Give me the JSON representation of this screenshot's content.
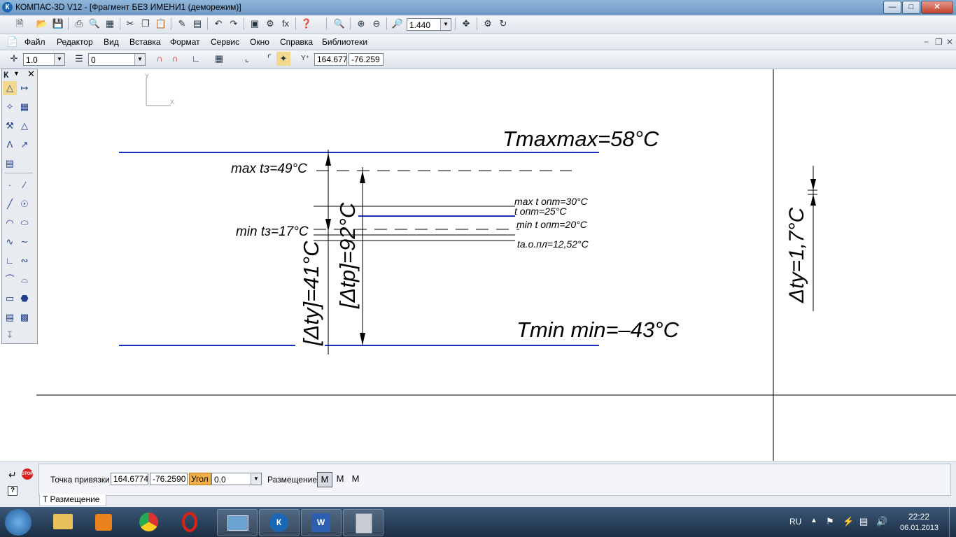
{
  "window": {
    "title": "КОМПАС-3D V12 - [Фрагмент БЕЗ ИМЕНИ1 (деморежим)]",
    "app_icon": "kompas-logo-icon",
    "controls": [
      "minimize-icon",
      "maximize-icon",
      "close-icon"
    ]
  },
  "standard_toolbar": {
    "zoom_value": "1.440"
  },
  "menu": {
    "items": [
      "Файл",
      "Редактор",
      "Вид",
      "Вставка",
      "Формат",
      "Сервис",
      "Окно",
      "Справка",
      "Библиотеки"
    ]
  },
  "current_state_bar": {
    "step_value": "1.0",
    "layer_value": "0",
    "coord_x": "164.677",
    "coord_y": "-76.259"
  },
  "palette": {
    "header": "К"
  },
  "drawing": {
    "axis_y": "Y",
    "axis_x": "X",
    "tmaxmax": "Tmaxmax=58°C",
    "tminmin": "Tmin min=–43°C",
    "max_t3": "max tз=49°C",
    "min_t3": "min tз=17°C",
    "max_topt": "max t опт=30°C",
    "t_opt": "t опт=25°C",
    "min_topt": "min t опт=20°C",
    "t_aopl": "tа.о.пл=12,52°C",
    "delta_ty_bracket": "[Δty]=41°C",
    "delta_tp_bracket": "[Δtp]=92°C",
    "delta_ty": "Δty=1,7°C"
  },
  "properties_panel": {
    "snap_label": "Точка привязки",
    "snap_x": "164.6774",
    "snap_y": "-76.2590",
    "angle_label": "Угол",
    "angle_value": "0.0",
    "placement_label": "Размещение",
    "tab_label": "Размещение",
    "stop_label": "STOP"
  },
  "taskbar": {
    "lang": "RU",
    "time": "22:22",
    "date": "06.01.2013"
  },
  "colors": {
    "accent_blue_line": "#1f2fb8",
    "title_bar": "#7ea6cf"
  }
}
